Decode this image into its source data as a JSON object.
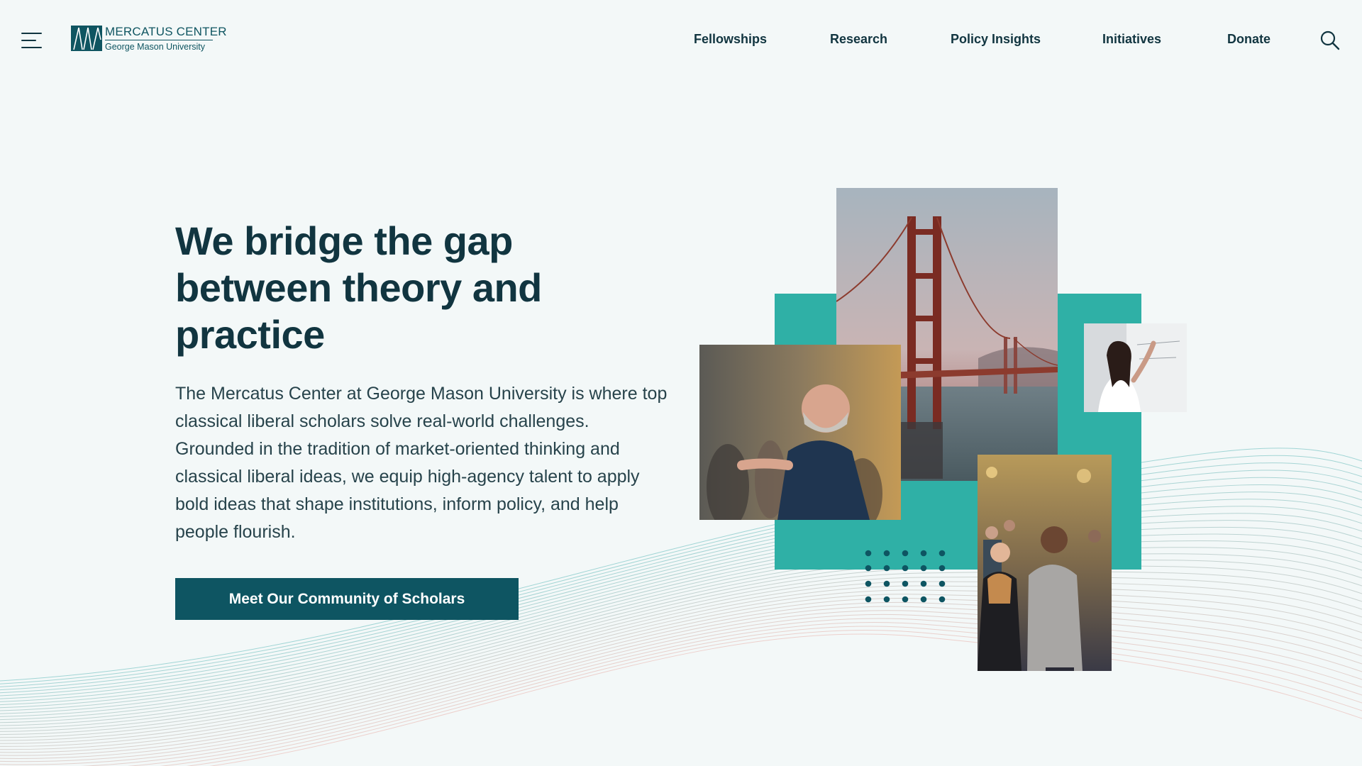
{
  "header": {
    "menu_icon": "hamburger-menu-icon",
    "logo": {
      "title": "MERCATUS CENTER",
      "subtitle": "George Mason University"
    },
    "nav": [
      {
        "label": "Fellowships"
      },
      {
        "label": "Research"
      },
      {
        "label": "Policy Insights"
      },
      {
        "label": "Initiatives"
      },
      {
        "label": "Donate"
      }
    ],
    "search_icon": "search-icon"
  },
  "hero": {
    "title": "We bridge the gap between theory and practice",
    "body": "The Mercatus Center at George Mason University is where top classical liberal scholars solve real-world challenges. Grounded in the tradition of market-oriented thinking and classical liberal ideas, we equip high-agency talent to apply bold ideas that shape institutions, inform policy, and help people flourish.",
    "cta_label": "Meet Our Community of Scholars"
  },
  "colors": {
    "brand_dark": "#0e5562",
    "accent_teal": "#2fb0a6",
    "heading": "#113540",
    "background": "#f3f8f8"
  }
}
